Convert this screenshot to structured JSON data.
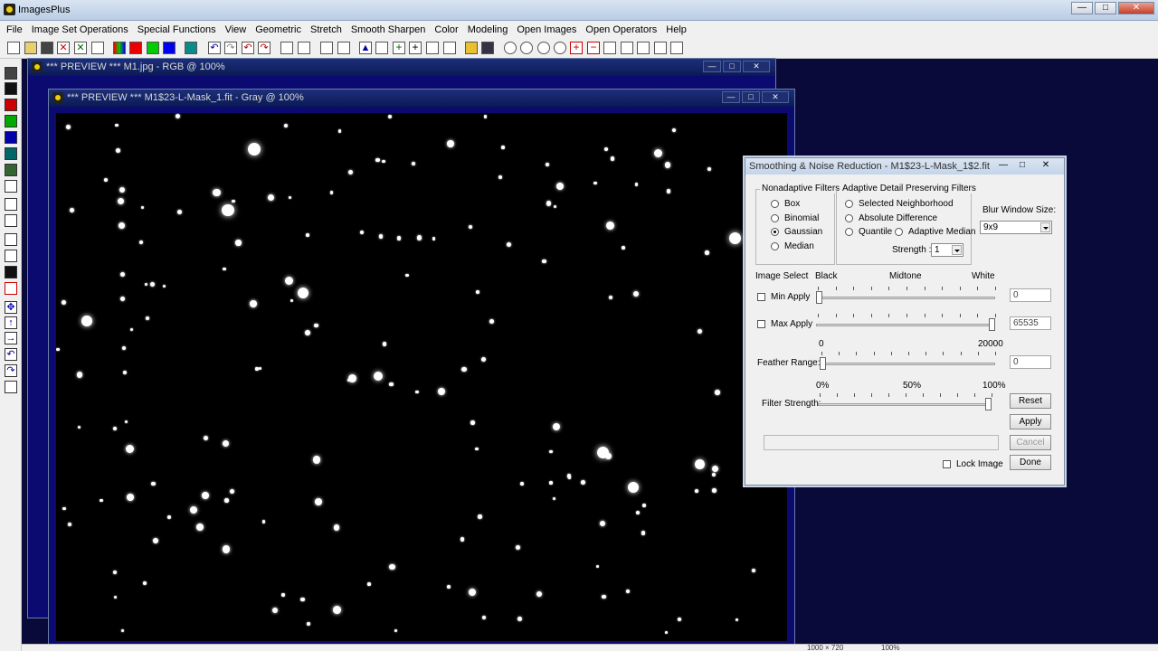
{
  "app": {
    "title": "ImagesPlus"
  },
  "menu": [
    "File",
    "Image Set Operations",
    "Special Functions",
    "View",
    "Geometric",
    "Stretch",
    "Smooth Sharpen",
    "Color",
    "Modeling",
    "Open Images",
    "Open Operators",
    "Help"
  ],
  "windows": {
    "back": {
      "title": "*** PREVIEW *** M1.jpg - RGB @ 100%"
    },
    "front": {
      "title": "*** PREVIEW *** M1$23-L-Mask_1.fit - Gray @ 100%"
    }
  },
  "dialog": {
    "title": "Smoothing & Noise Reduction - M1$23-L-Mask_1$2.fit",
    "nonadaptive": {
      "label": "Nonadaptive Filters",
      "options": [
        "Box",
        "Binomial",
        "Gaussian",
        "Median"
      ],
      "selected": "Gaussian"
    },
    "adaptive": {
      "label": "Adaptive Detail Preserving Filters",
      "options": [
        "Selected Neighborhood",
        "Absolute Difference",
        "Quantile",
        "Adaptive Median"
      ],
      "strength_label": "Strength :",
      "strength_value": "1"
    },
    "blur": {
      "label": "Blur Window Size:",
      "value": "9x9"
    },
    "image_select": {
      "label": "Image Select",
      "black": "Black",
      "midtone": "Midtone",
      "white": "White"
    },
    "min_apply": {
      "label": "Min Apply",
      "value": "0",
      "checked": false,
      "fraction": 0.0
    },
    "max_apply": {
      "label": "Max Apply",
      "value": "65535",
      "checked": false,
      "fraction": 1.0
    },
    "feather": {
      "label": "Feather Range:",
      "min": "0",
      "max": "20000",
      "value": "0",
      "fraction": 0.0
    },
    "filter_strength": {
      "label": "Filter Strength:",
      "p0": "0%",
      "p50": "50%",
      "p100": "100%",
      "fraction": 1.0
    },
    "buttons": {
      "reset": "Reset",
      "apply": "Apply",
      "cancel": "Cancel",
      "done": "Done"
    },
    "lock_image": {
      "label": "Lock Image",
      "checked": false
    }
  },
  "status": {
    "size": "1000 × 720",
    "zoom": "100%"
  }
}
